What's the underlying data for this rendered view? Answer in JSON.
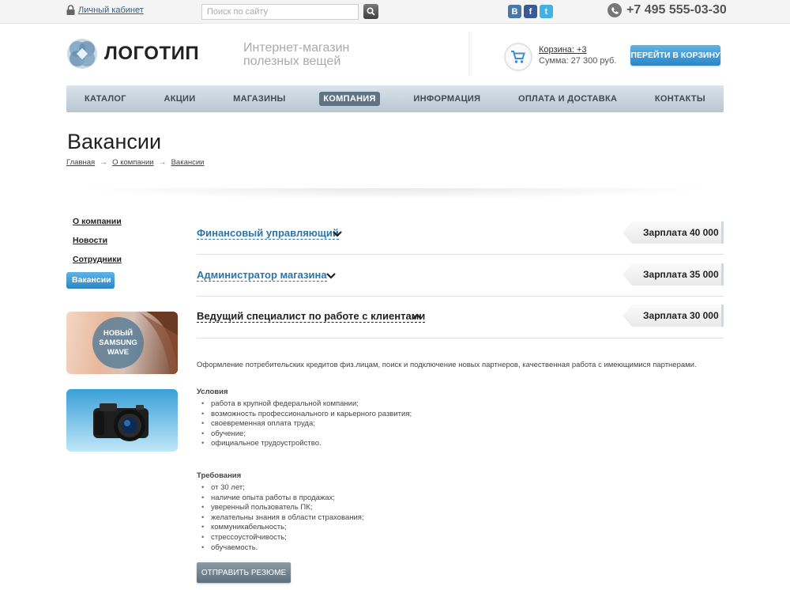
{
  "topbar": {
    "cabinet_label": "Личный кабинет",
    "search_placeholder": "Поиск по сайту",
    "social": [
      {
        "name": "vk",
        "glyph": "В",
        "color": "#4a76a8"
      },
      {
        "name": "facebook",
        "glyph": "f",
        "color": "#3b5998"
      },
      {
        "name": "twitter",
        "glyph": "t",
        "color": "#44b0e3"
      }
    ],
    "phone": "+7 495 555-03-30"
  },
  "header": {
    "logo_text": "ЛОГОТИП",
    "tagline_line1": "Интернет-магазин",
    "tagline_line2": "полезных вещей",
    "cart_link": "Корзина: +3",
    "cart_sum": "Сумма: 27 300 руб.",
    "cart_button": "ПЕРЕЙТИ В КОРЗИНУ"
  },
  "nav": {
    "items": [
      {
        "label": "КАТАЛОГ",
        "active": false
      },
      {
        "label": "АКЦИИ",
        "active": false
      },
      {
        "label": "МАГАЗИНЫ",
        "active": false
      },
      {
        "label": "КОМПАНИЯ",
        "active": true
      },
      {
        "label": "ИНФОРМАЦИЯ",
        "active": false
      },
      {
        "label": "ОПЛАТА И ДОСТАВКА",
        "active": false
      },
      {
        "label": "КОНТАКТЫ",
        "active": false
      }
    ]
  },
  "page": {
    "title": "Вакансии",
    "breadcrumb": [
      "Главная",
      "О компании",
      "Вакансии"
    ]
  },
  "sidebar": {
    "items": [
      {
        "label": "О компании",
        "active": false
      },
      {
        "label": "Новости",
        "active": false
      },
      {
        "label": "Сотрудники",
        "active": false
      },
      {
        "label": "Вакансии",
        "active": true
      }
    ],
    "banner1_line1": "НОВЫЙ",
    "banner1_line2": "SAMSUNG",
    "banner1_line3": "WAVE"
  },
  "vacancies": [
    {
      "title": "Финансовый управляющий",
      "salary": "Зарплата 40 000",
      "open": false
    },
    {
      "title": "Администратор магазина",
      "salary": "Зарплата 35 000",
      "open": false
    },
    {
      "title": "Ведущий специалист по работе с клиентами",
      "salary": "Зарплата 30 000",
      "open": true
    }
  ],
  "open_vacancy": {
    "description": "Оформление потребительских кредитов физ.лицам, поиск и подключение новых партнеров, качественная работа с имеющимися партнерами.",
    "conditions_title": "Условия",
    "conditions": [
      "работа в крупной федеральной компании;",
      "возможность профессионального и карьерного развития;",
      "своевременная оплата труда;",
      "обучение;",
      "официальное трудоустройство."
    ],
    "requirements_title": "Требования",
    "requirements": [
      "от 30 лет;",
      "наличие опыта работы в продажах;",
      "уверенный пользователь ПК;",
      "желательны знания в области страхования;",
      "коммуникабельность;",
      "стрессоустойчивость;",
      "обучаемость."
    ],
    "resume_button": "ОТПРАВИТЬ РЕЗЮМЕ"
  },
  "colors": {
    "accent_blue": "#2b86c4",
    "link_blue": "#2d74a8",
    "nav_active": "#5f7385"
  }
}
